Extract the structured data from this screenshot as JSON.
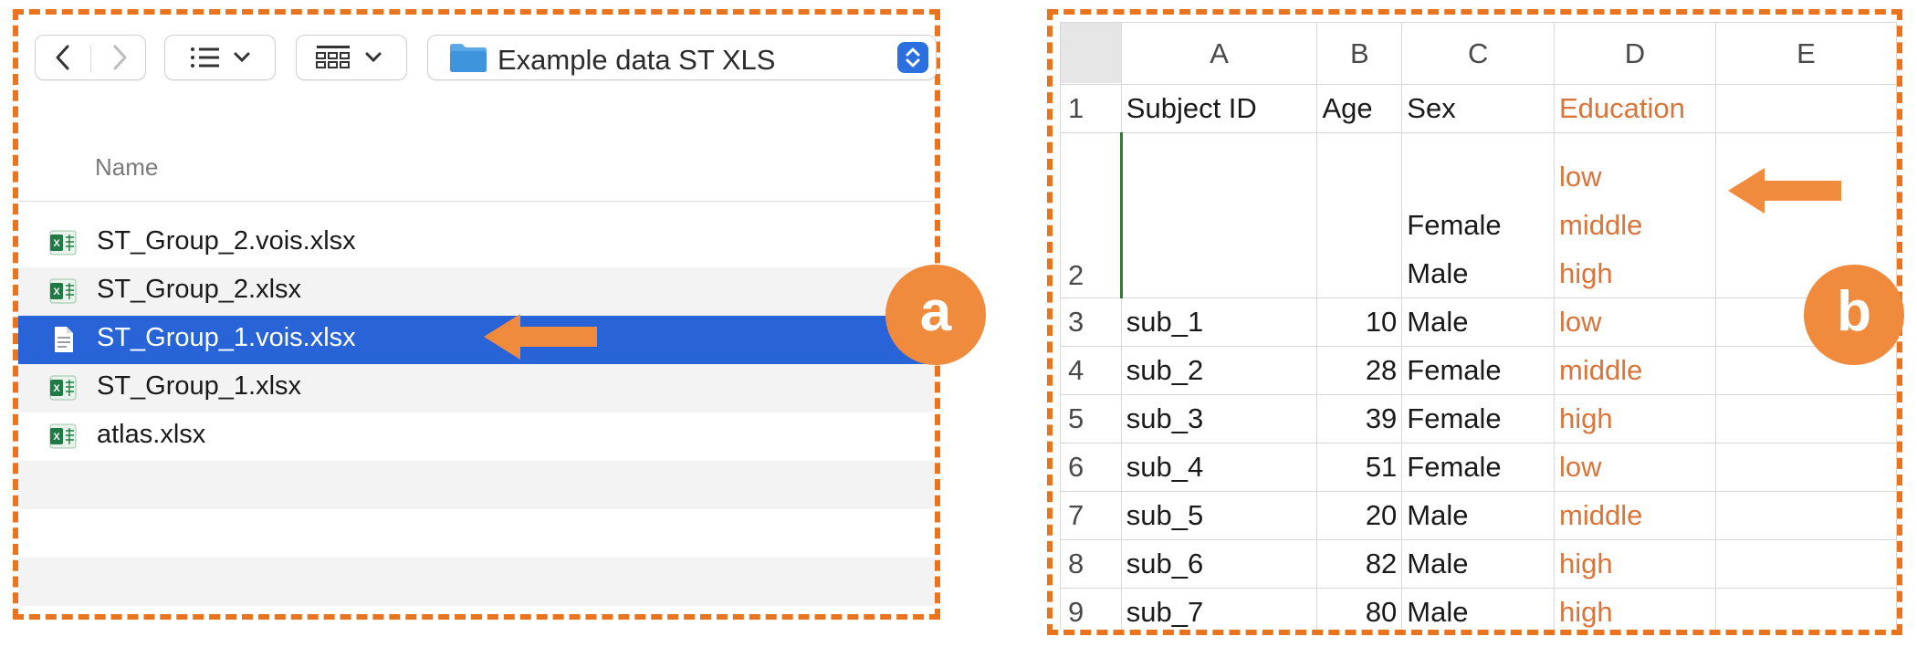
{
  "finder": {
    "path_label": "Example data ST XLS",
    "name_header": "Name",
    "files": [
      {
        "name": "ST_Group_2.vois.xlsx",
        "selected": false
      },
      {
        "name": "ST_Group_2.xlsx",
        "selected": false
      },
      {
        "name": "ST_Group_1.vois.xlsx",
        "selected": true
      },
      {
        "name": "ST_Group_1.xlsx",
        "selected": false
      },
      {
        "name": "atlas.xlsx",
        "selected": false
      }
    ],
    "badge": "a"
  },
  "sheet": {
    "columns": [
      "A",
      "B",
      "C",
      "D",
      "E"
    ],
    "row_numbers": [
      "1",
      "2",
      "3",
      "4",
      "5",
      "6",
      "7",
      "8",
      "9"
    ],
    "header": {
      "a": "Subject ID",
      "b": "Age",
      "c": "Sex",
      "d": "Education"
    },
    "row2": {
      "c": [
        "Female",
        "Male"
      ],
      "d": [
        "low",
        "middle",
        "high"
      ]
    },
    "rows": [
      {
        "id": "sub_1",
        "age": "10",
        "sex": "Male",
        "edu": "low"
      },
      {
        "id": "sub_2",
        "age": "28",
        "sex": "Female",
        "edu": "middle"
      },
      {
        "id": "sub_3",
        "age": "39",
        "sex": "Female",
        "edu": "high"
      },
      {
        "id": "sub_4",
        "age": "51",
        "sex": "Female",
        "edu": "low"
      },
      {
        "id": "sub_5",
        "age": "20",
        "sex": "Male",
        "edu": "middle"
      },
      {
        "id": "sub_6",
        "age": "82",
        "sex": "Male",
        "edu": "high"
      },
      {
        "id": "sub_7",
        "age": "80",
        "sex": "Male",
        "edu": "high"
      }
    ],
    "badge": "b"
  },
  "colors": {
    "accent_orange": "#E8741F",
    "selection_blue": "#2864d8",
    "education_text": "#D9743A"
  }
}
